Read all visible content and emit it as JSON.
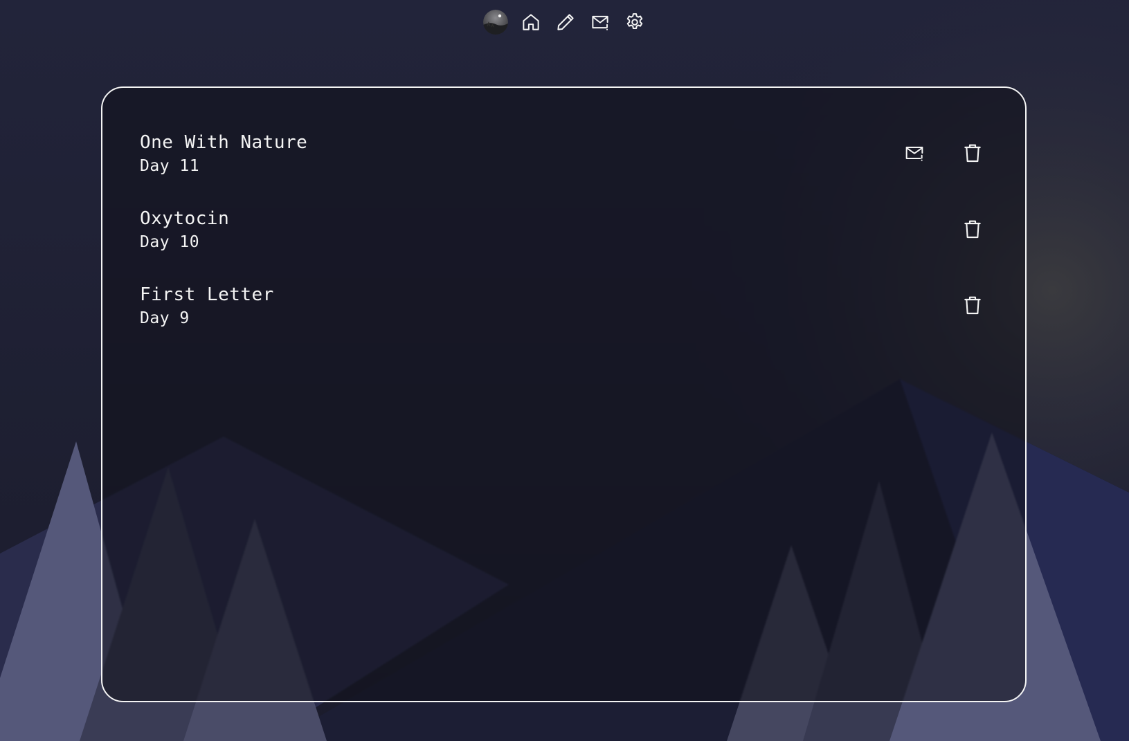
{
  "nav": {
    "items": [
      {
        "id": "avatar",
        "icon": "avatar-moon-landscape"
      },
      {
        "id": "home",
        "icon": "home-icon"
      },
      {
        "id": "write",
        "icon": "pencil-icon"
      },
      {
        "id": "mail",
        "icon": "mail-alert-icon"
      },
      {
        "id": "settings",
        "icon": "gear-icon"
      }
    ]
  },
  "entries": [
    {
      "title": "One With Nature",
      "day": "Day 11",
      "has_mail": true
    },
    {
      "title": "Oxytocin",
      "day": "Day 10",
      "has_mail": false
    },
    {
      "title": "First Letter",
      "day": "Day 9",
      "has_mail": false
    }
  ],
  "colors": {
    "background": "#1f2033",
    "panel_border": "#f4f4f4",
    "text": "#f4f4f4",
    "mountain_dark": "#232541",
    "tree_light": "#5a5b78"
  }
}
